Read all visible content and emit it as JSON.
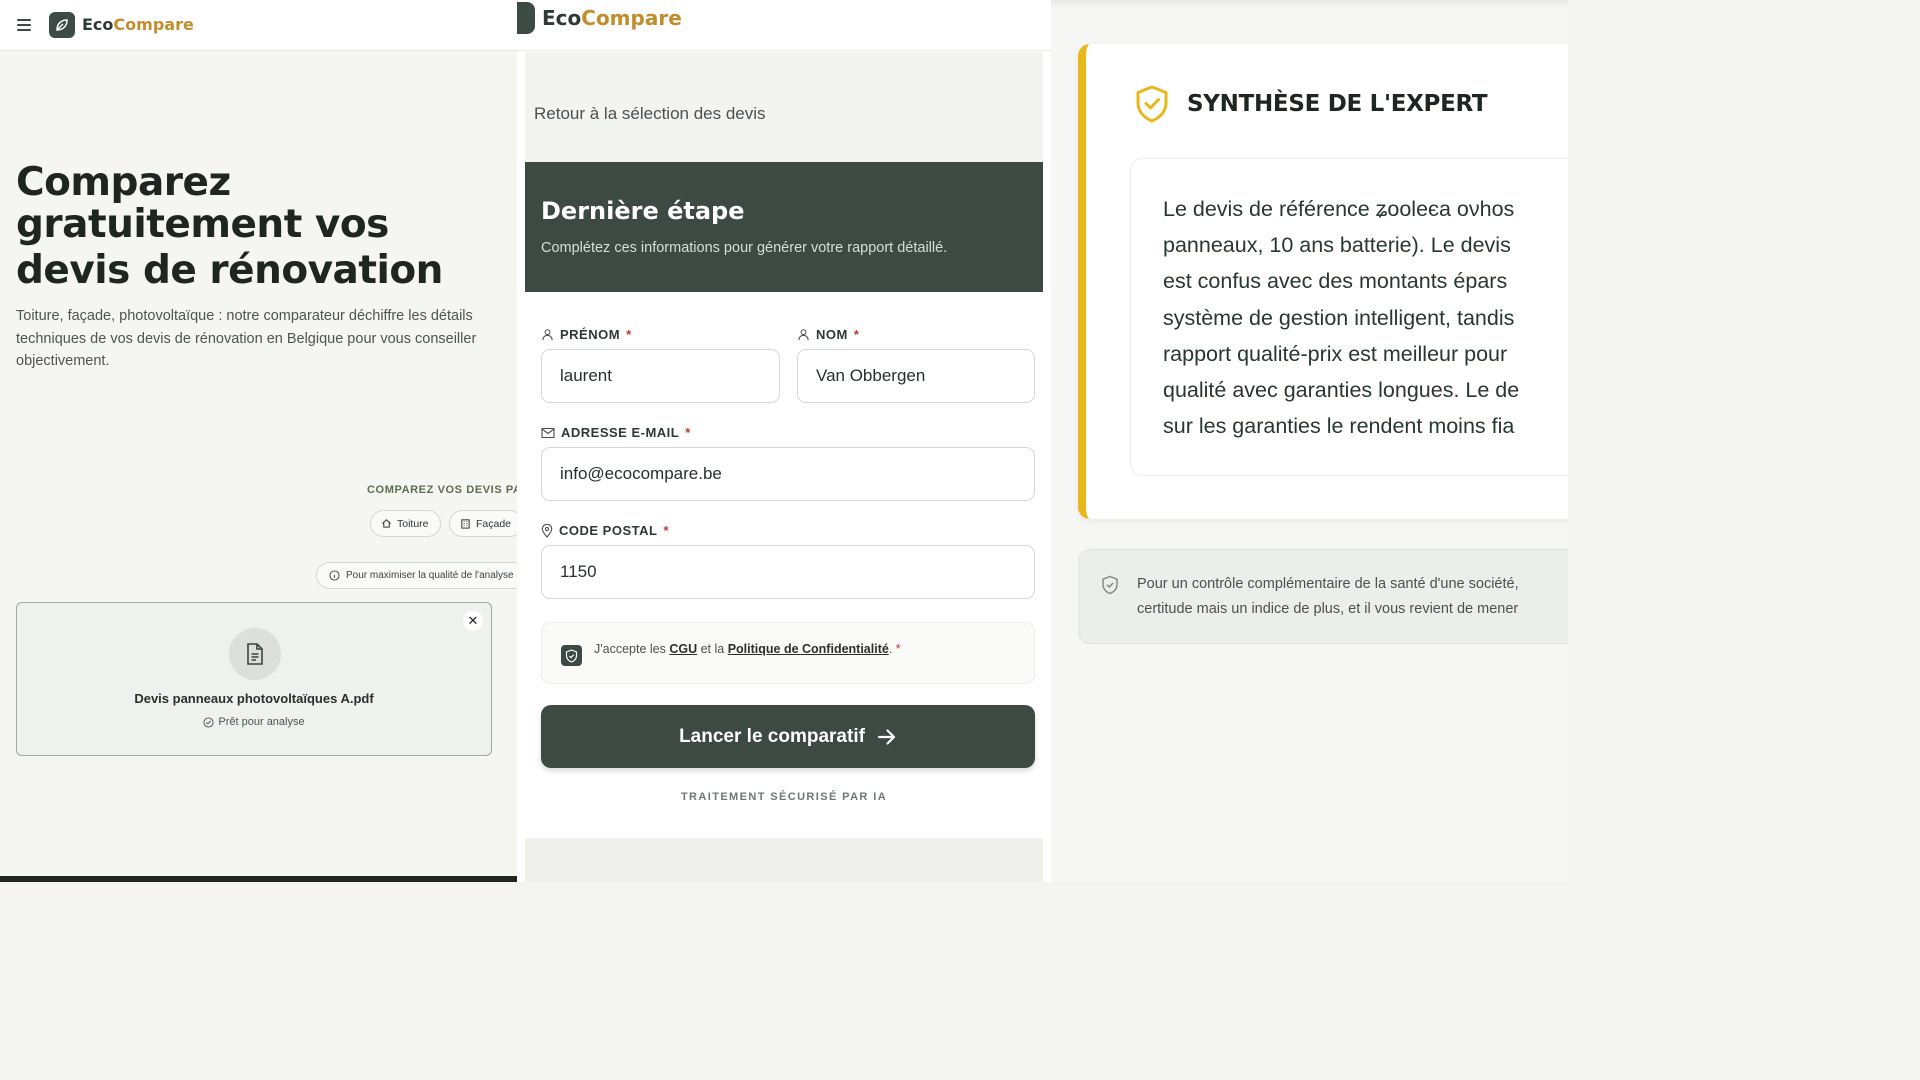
{
  "brand": {
    "part1": "Eco",
    "part2": "Compare",
    "colors": {
      "dark": "#3c4a43",
      "gold": "#c28d2c",
      "yellow_accent": "#e8b71c"
    }
  },
  "landing": {
    "title_line1": "Comparez",
    "title_line2": "gratuitement vos",
    "title_line3": "devis de rénovation",
    "description": "Toiture, façade, photovoltaïque : notre comparateur déchiffre les détails techniques de vos devis de rénovation en Belgique pour vous conseiller objectivement.",
    "compare_label": "COMPAREZ VOS DEVIS PA",
    "chips": [
      {
        "label": "Toiture",
        "icon": "home-icon"
      },
      {
        "label": "Façade",
        "icon": "building-icon"
      }
    ],
    "tip": "Pour maximiser la qualité de l'analyse",
    "file": {
      "name": "Devis panneaux photovoltaïques A.pdf",
      "status": "Prêt pour analyse"
    }
  },
  "form": {
    "back_link": "Retour à la sélection des devis",
    "title": "Dernière étape",
    "subtitle": "Complétez ces informations pour générer votre rapport détaillé.",
    "fields": {
      "prenom": {
        "label": "PRÉNOM",
        "value": "laurent"
      },
      "nom": {
        "label": "NOM",
        "value": "Van Obbergen"
      },
      "email": {
        "label": "ADRESSE E-MAIL",
        "value": "info@ecocompare.be"
      },
      "postal": {
        "label": "CODE POSTAL",
        "value": "1150"
      }
    },
    "required_mark": "*",
    "consent": {
      "prefix": "J'accepte les ",
      "cgu": "CGU",
      "middle": " et la ",
      "privacy": "Politique de Confidentialité",
      "suffix": ".",
      "checked": true
    },
    "submit_label": "Lancer le comparatif",
    "secure_note": "TRAITEMENT SÉCURISÉ PAR IA"
  },
  "expert": {
    "title": "SYNTHÈSE DE L'EXPERT",
    "lines": [
      "Le devis de référence ʑooleєa oνhos",
      "panneaux, 10 ans batterie). Le devis",
      "est confus avec des montants épars",
      "système de gestion intelligent, tandis",
      "rapport qualité-prix est meilleur pour",
      "qualité avec garanties longues. Le de",
      "sur les garanties le rendent moins fia"
    ],
    "info_lines": [
      "Pour un contrôle complémentaire de la santé d'une société,",
      "certitude mais un indice de plus, et il vous revient de mener"
    ]
  }
}
